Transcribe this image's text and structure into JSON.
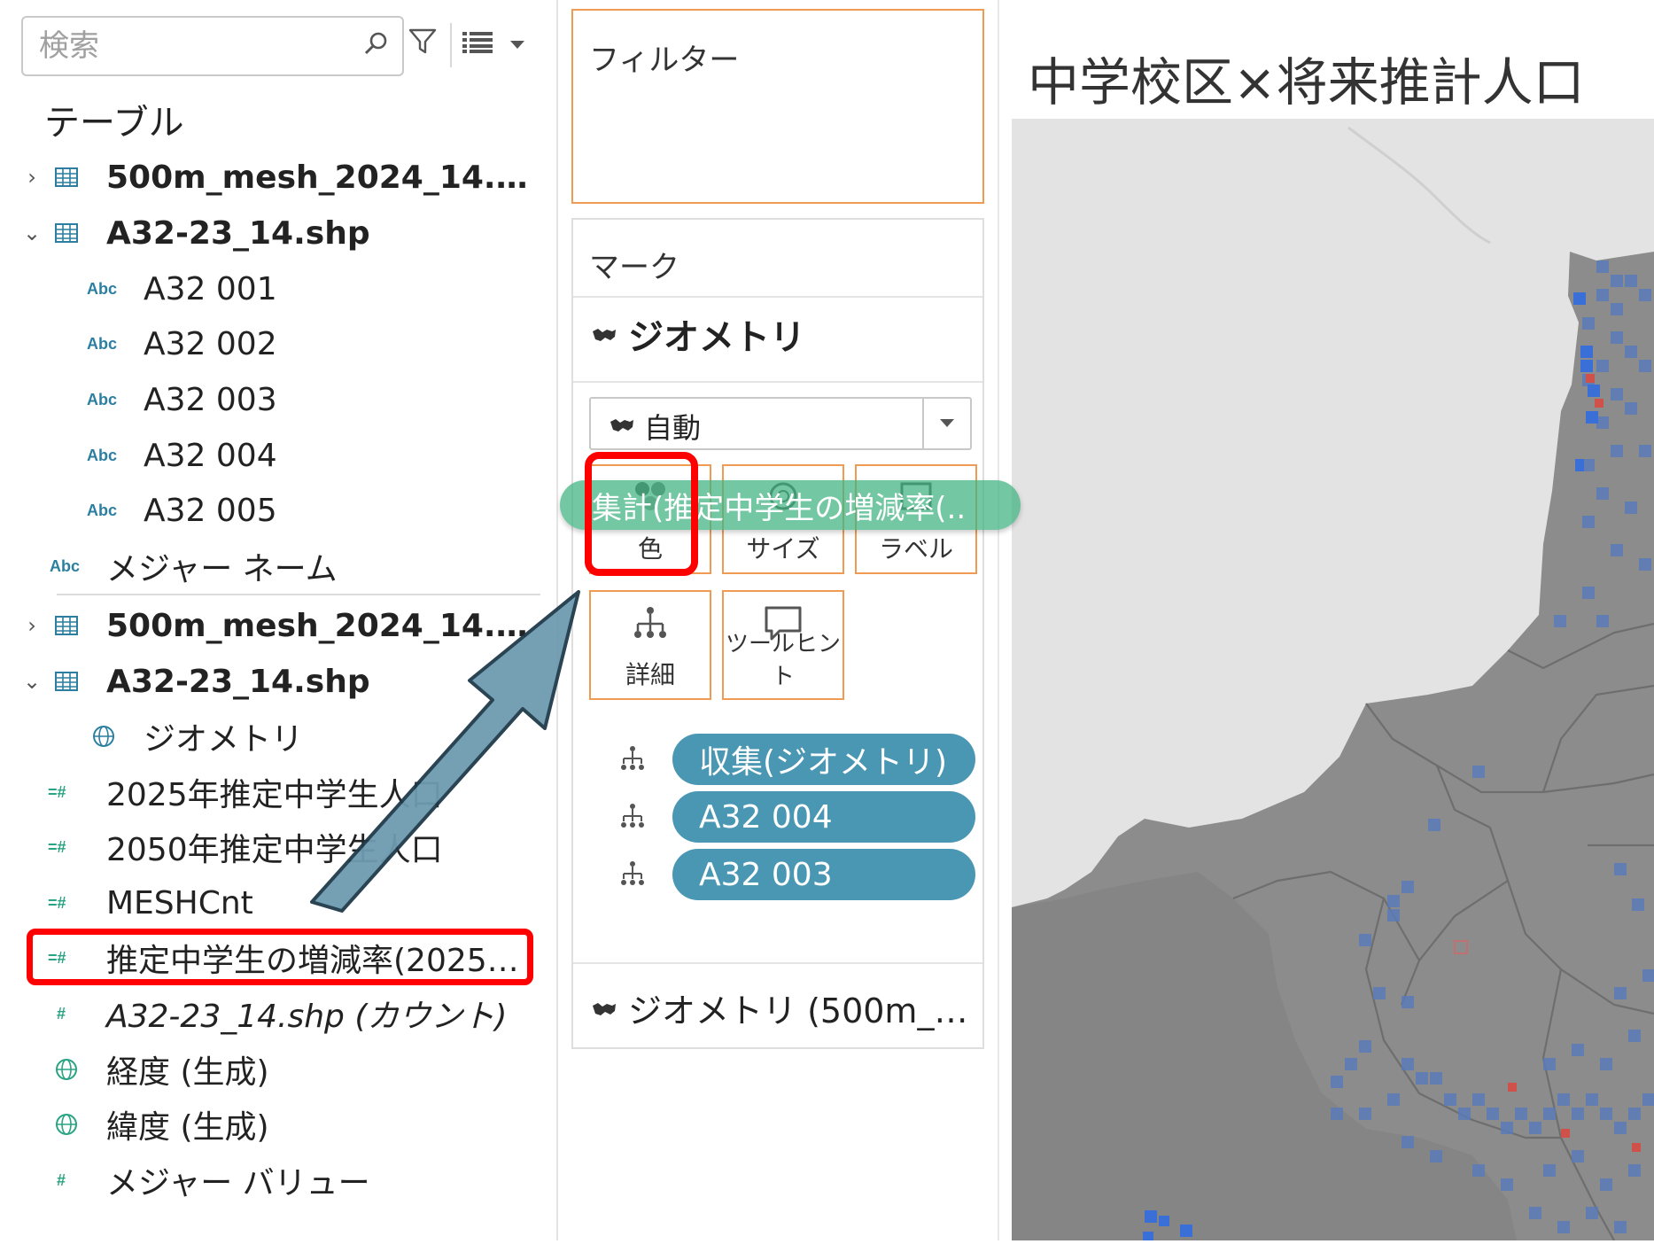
{
  "search": {
    "placeholder": "検索"
  },
  "data_pane": {
    "tables_header": "テーブル",
    "rows": [
      {
        "label": "500m_mesh_2024_14.…"
      },
      {
        "label": "A32-23_14.shp"
      },
      {
        "label": "A32 001"
      },
      {
        "label": "A32 002"
      },
      {
        "label": "A32 003"
      },
      {
        "label": "A32 004"
      },
      {
        "label": "A32 005"
      },
      {
        "label": "メジャー ネーム"
      },
      {
        "label": "500m_mesh_2024_14.…"
      },
      {
        "label": "A32-23_14.shp"
      },
      {
        "label": "ジオメトリ"
      },
      {
        "label": "2025年推定中学生人口"
      },
      {
        "label": "2050年推定中学生人口"
      },
      {
        "label": "MESHCnt"
      },
      {
        "label": "推定中学生の増減率(2025…"
      },
      {
        "label": "A32-23_14.shp (カウント)"
      },
      {
        "label": "経度 (生成)"
      },
      {
        "label": "緯度 (生成)"
      },
      {
        "label": "メジャー バリュー"
      }
    ],
    "abc_glyph": "Abc",
    "measure_glyph": "=#",
    "hash_glyph": "#"
  },
  "filters": {
    "title": "フィルター"
  },
  "marks": {
    "title": "マーク",
    "layer_title": "ジオメトリ",
    "mark_type": "自動",
    "buttons": {
      "color": "色",
      "size": "サイズ",
      "label": "ラベル",
      "detail": "詳細",
      "tooltip": "ツールヒント"
    },
    "pills": [
      "収集(ジオメトリ)",
      "A32 004",
      "A32 003"
    ],
    "footer_layer": "ジオメトリ (500m_…"
  },
  "drag_pill": {
    "label": "集計(推定中学生の増減率(.."
  },
  "sheet": {
    "title": "中学校区×将来推計人口"
  },
  "colors": {
    "accent_orange": "#ef9b54",
    "pill_blue": "#4a97b3",
    "drag_green": "#3eb280",
    "highlight_red": "#ff0000",
    "map_land": "#8c8c8c",
    "map_bg": "#e8e8e8"
  }
}
